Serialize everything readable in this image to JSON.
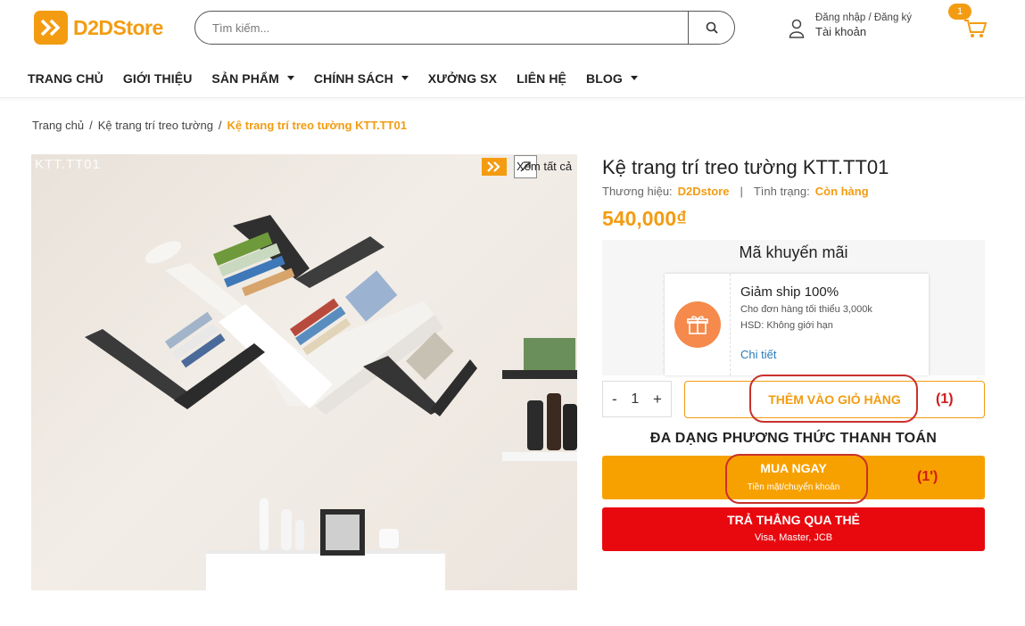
{
  "header": {
    "logo_text": "D2DStore",
    "search_placeholder": "Tìm kiếm...",
    "account_small": "Đăng nhập / Đăng ký",
    "account_big": "Tài khoản",
    "cart_count": "1"
  },
  "nav": {
    "items": [
      {
        "label": "TRANG CHỦ",
        "has_dropdown": false
      },
      {
        "label": "GIỚI THIỆU",
        "has_dropdown": false
      },
      {
        "label": "SẢN PHẨM",
        "has_dropdown": true
      },
      {
        "label": "CHÍNH SÁCH",
        "has_dropdown": true
      },
      {
        "label": "XƯỞNG SX",
        "has_dropdown": false
      },
      {
        "label": "LIÊN HỆ",
        "has_dropdown": false
      },
      {
        "label": "BLOG",
        "has_dropdown": true
      }
    ]
  },
  "breadcrumb": {
    "items": [
      "Trang chủ",
      "Kệ trang trí treo tường"
    ],
    "current": "Kệ trang trí treo tường KTT.TT01"
  },
  "gallery": {
    "image_code": "KTT.TT01",
    "see_all": "Xem tất cả"
  },
  "product": {
    "title": "Kệ trang trí treo tường KTT.TT01",
    "brand_label": "Thương hiệu:",
    "brand": "D2Dstore",
    "separator": "|",
    "status_label": "Tình trạng:",
    "status": "Còn hàng",
    "price": "540,000₫"
  },
  "promo": {
    "title": "Mã khuyến mãi",
    "coupon_title": "Giảm ship 100%",
    "coupon_min": "Cho đơn hàng tối thiểu 3,000k",
    "coupon_expiry": "HSD: Không giới hạn",
    "coupon_link": "Chi tiết"
  },
  "purchase": {
    "qty_minus": "-",
    "qty_value": "1",
    "qty_plus": "+",
    "add_to_cart": "THÊM VÀO GIỎ HÀNG",
    "payment_heading": "ĐA DẠNG PHƯƠNG THỨC THANH TOÁN",
    "buy_now": "MUA NGAY",
    "buy_now_sub": "Tiền mặt/chuyển khoản",
    "pay_card": "TRẢ THẲNG QUA THẺ",
    "pay_card_sub": "Visa, Master, JCB"
  },
  "annotations": {
    "label_1": "(1)",
    "label_1b": "(1')"
  },
  "colors": {
    "accent": "#f39c12",
    "buy_now": "#f7a100",
    "pay_card": "#e8090f",
    "annotation": "#c9302c"
  }
}
